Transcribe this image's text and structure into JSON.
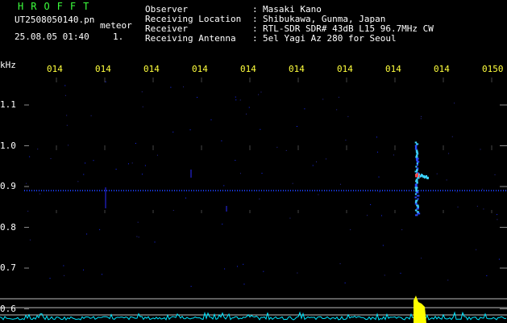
{
  "header": {
    "brand": "HROFFT",
    "filename": "UT2508050140.pn",
    "detection": "meteor",
    "datetime": "25.08.05 01:40",
    "count": "1.",
    "fields": [
      {
        "label": "Observer",
        "value": "Masaki Kano"
      },
      {
        "label": "Receiving Location",
        "value": "Shibukawa, Gunma, Japan"
      },
      {
        "label": "Receiver",
        "value": "RTL-SDR SDR# 43dB L15 96.7MHz CW"
      },
      {
        "label": "Receiving Antenna",
        "value": "5el Yagi Az 280 for Seoul"
      }
    ],
    "separator": ":"
  },
  "axis": {
    "y_unit": "kHz",
    "y_ticks": [
      "1.1",
      "1.0",
      "0.9",
      "0.8",
      "0.7",
      "0.6"
    ],
    "x_ticks": [
      "014",
      "014",
      "014",
      "014",
      "014",
      "014",
      "014",
      "014",
      "014",
      "0150"
    ]
  },
  "colors": {
    "background": "#000000",
    "brand": "#3cff3c",
    "header_text": "#ffffff",
    "x_ticks": "#ffff3c",
    "baseline": "#1a3cff",
    "echo": "#3cd2ff",
    "echo_core": "#ff4646",
    "spectrum": "#00e6ff",
    "spectrum_peak": "#ffff00"
  },
  "chart_data": {
    "type": "heatmap",
    "x_ticks": [
      "014",
      "014",
      "014",
      "014",
      "014",
      "014",
      "014",
      "014",
      "014",
      "0150"
    ],
    "y_ticks": [
      "1.1",
      "1.0",
      "0.9",
      "0.8",
      "0.7",
      "0.6"
    ],
    "ylabel": "kHz",
    "ylim": [
      0.55,
      1.15
    ],
    "carrier_khz": 0.89,
    "meteor_echo": {
      "minute": 1.48,
      "khz_low": 0.83,
      "khz_high": 1.01,
      "peak_khz": 0.925
    }
  }
}
